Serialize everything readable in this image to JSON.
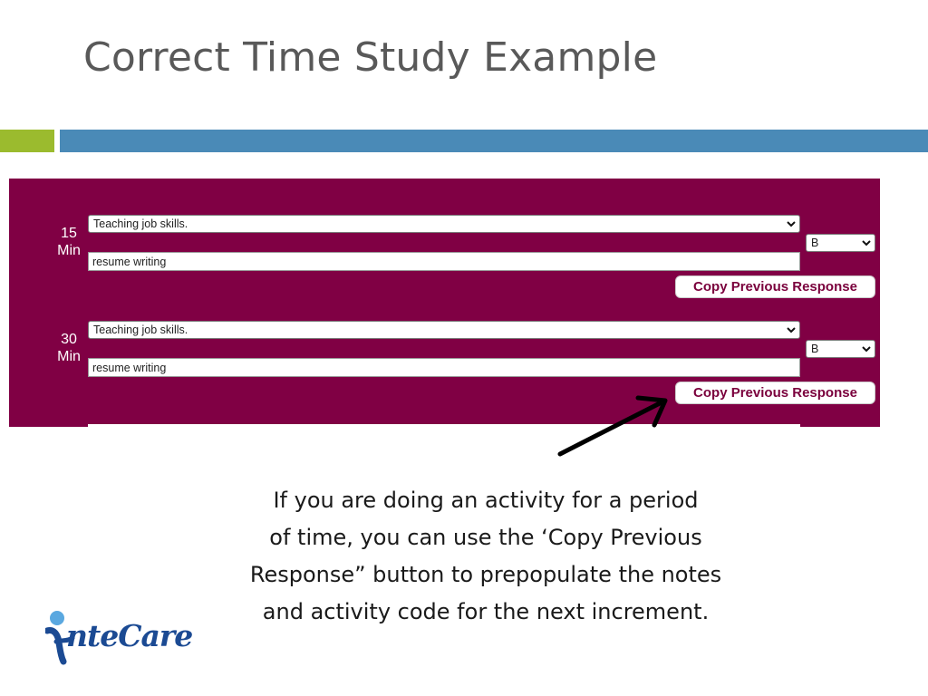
{
  "slide": {
    "title": "Correct Time Study Example"
  },
  "time_study": {
    "slots": [
      {
        "label_number": "15",
        "label_unit": "Min",
        "activity_value": "Teaching job skills.",
        "code_value": "B",
        "notes_value": "resume writing",
        "copy_button_label": "Copy Previous Response"
      },
      {
        "label_number": "30",
        "label_unit": "Min",
        "activity_value": "Teaching job skills.",
        "code_value": "B",
        "notes_value": "resume writing",
        "copy_button_label": "Copy Previous Response"
      }
    ]
  },
  "caption": {
    "lines": [
      "If you are doing an activity for a period",
      "of  time, you can use the ‘Copy Previous",
      "Response” button to prepopulate the notes",
      "and activity code for the next increment."
    ]
  },
  "logo": {
    "text": "nteCare"
  },
  "colors": {
    "panel_bg": "#800044",
    "bar_green": "#9bbb2e",
    "bar_blue": "#4a8ab7",
    "button_text": "#7a003c",
    "logo_blue": "#1b4a93",
    "logo_light_blue": "#5aa8e0"
  },
  "icons": {
    "dropdown": "chevron-down-icon",
    "arrow": "arrow-pointer-icon",
    "logo_figure": "person-figure-icon"
  }
}
